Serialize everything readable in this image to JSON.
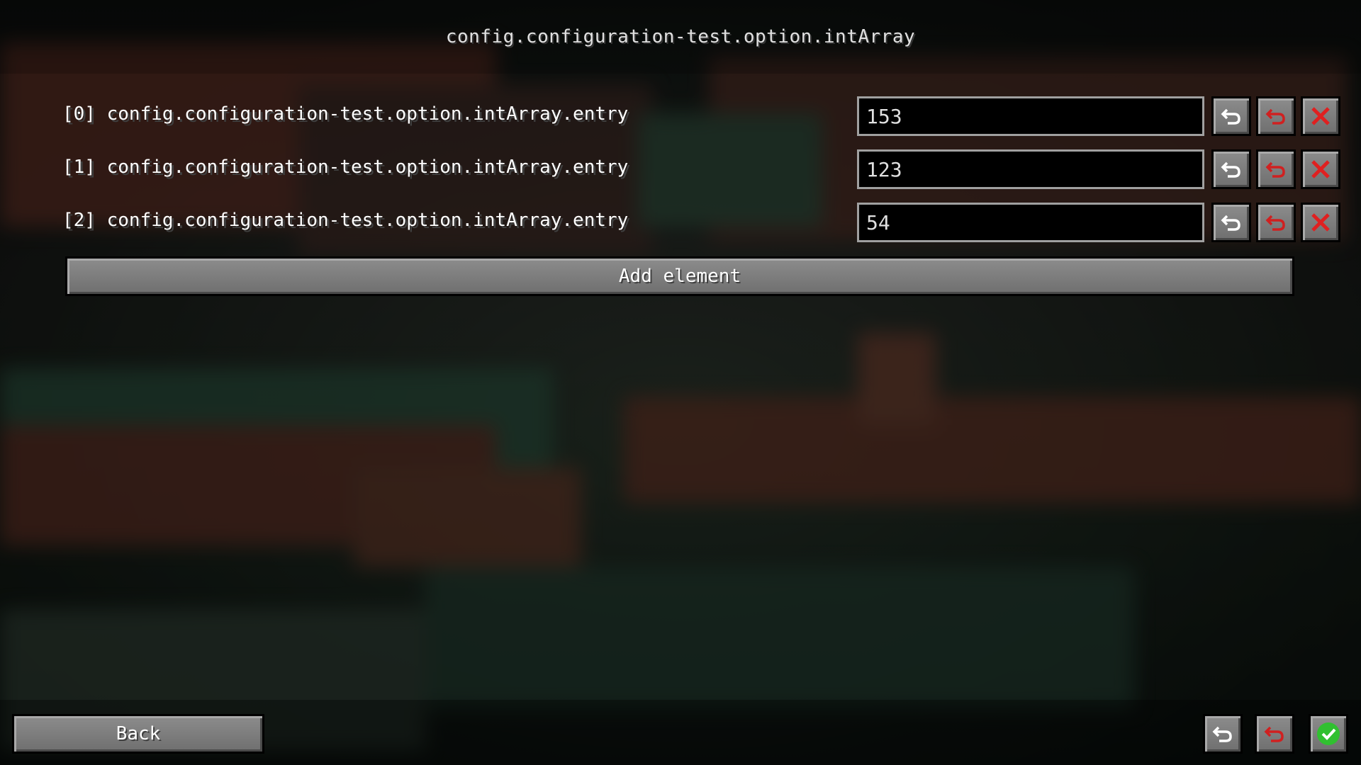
{
  "header": {
    "title": "config.configuration-test.option.intArray"
  },
  "entries": [
    {
      "label": "[0] config.configuration-test.option.intArray.entry",
      "value": "153"
    },
    {
      "label": "[1] config.configuration-test.option.intArray.entry",
      "value": "123"
    },
    {
      "label": "[2] config.configuration-test.option.intArray.entry",
      "value": "54"
    }
  ],
  "add_button": {
    "label": "Add element"
  },
  "footer": {
    "back_label": "Back"
  },
  "icons": {
    "undo": "undo-icon",
    "reset_default": "reset-default-icon",
    "remove": "remove-icon",
    "confirm": "checkmark-icon"
  },
  "colors": {
    "reset_red": "#d02020",
    "remove_red": "#e02020",
    "confirm_green": "#30c030"
  }
}
